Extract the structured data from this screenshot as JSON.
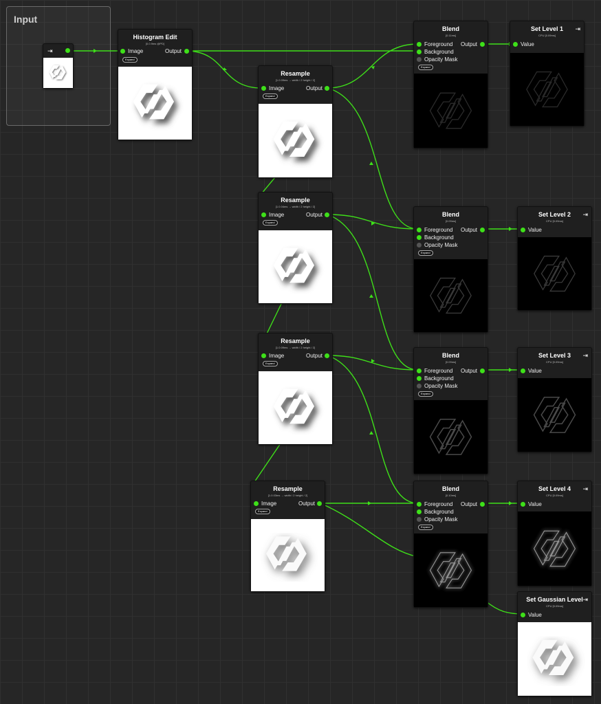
{
  "group": {
    "title": "Input"
  },
  "input_node": {
    "icon": "import-icon"
  },
  "histogram": {
    "title": "Histogram Edit",
    "timing": "[0.0.9ms @PD]",
    "in_label": "Image",
    "out_label": "Output",
    "expand": "Expand"
  },
  "resample": [
    {
      "title": "Resample",
      "timing": "[1.0.09ms → width / 2 height / 2]",
      "in_label": "Image",
      "out_label": "Output",
      "expand": "Expand"
    },
    {
      "title": "Resample",
      "timing": "[1.0.04ms → width / 2 height / 2]",
      "in_label": "Image",
      "out_label": "Output",
      "expand": "Expand"
    },
    {
      "title": "Resample",
      "timing": "[1.0.09ms → width / 2 height / 2]",
      "in_label": "Image",
      "out_label": "Output",
      "expand": "Expand"
    },
    {
      "title": "Resample",
      "timing": "[1.0.03ms → width / 2 height / 2]",
      "in_label": "Image",
      "out_label": "Output",
      "expand": "Expand"
    }
  ],
  "blend": [
    {
      "title": "Blend",
      "timing": "[0.11ms]",
      "fg": "Foreground",
      "bg": "Background",
      "mask": "Opacity Mask",
      "out_label": "Output",
      "expand": "Expand"
    },
    {
      "title": "Blend",
      "timing": "[0.09ms]",
      "fg": "Foreground",
      "bg": "Background",
      "mask": "Opacity Mask",
      "out_label": "Output",
      "expand": "Expand"
    },
    {
      "title": "Blend",
      "timing": "[0.09ms]",
      "fg": "Foreground",
      "bg": "Background",
      "mask": "Opacity Mask",
      "out_label": "Output",
      "expand": "Expand"
    },
    {
      "title": "Blend",
      "timing": "[0.10ms]",
      "fg": "Foreground",
      "bg": "Background",
      "mask": "Opacity Mask",
      "out_label": "Output",
      "expand": "Expand"
    }
  ],
  "setlevel": [
    {
      "title": "Set Level 1",
      "timing": "CPU [0.09ms]",
      "value_label": "Value"
    },
    {
      "title": "Set Level 2",
      "timing": "CPU [0.09ms]",
      "value_label": "Value"
    },
    {
      "title": "Set Level 3",
      "timing": "CPU [0.09ms]",
      "value_label": "Value"
    },
    {
      "title": "Set Level 4",
      "timing": "CPU [0.09ms]",
      "value_label": "Value"
    },
    {
      "title": "Set Gaussian Level",
      "timing": "CPU [0.09ms]",
      "value_label": "Value"
    }
  ],
  "colors": {
    "wire": "#3ee019",
    "background": "#262626",
    "node": "#1f1f1f"
  },
  "icons": {
    "export": "export-icon",
    "import": "import-icon"
  }
}
